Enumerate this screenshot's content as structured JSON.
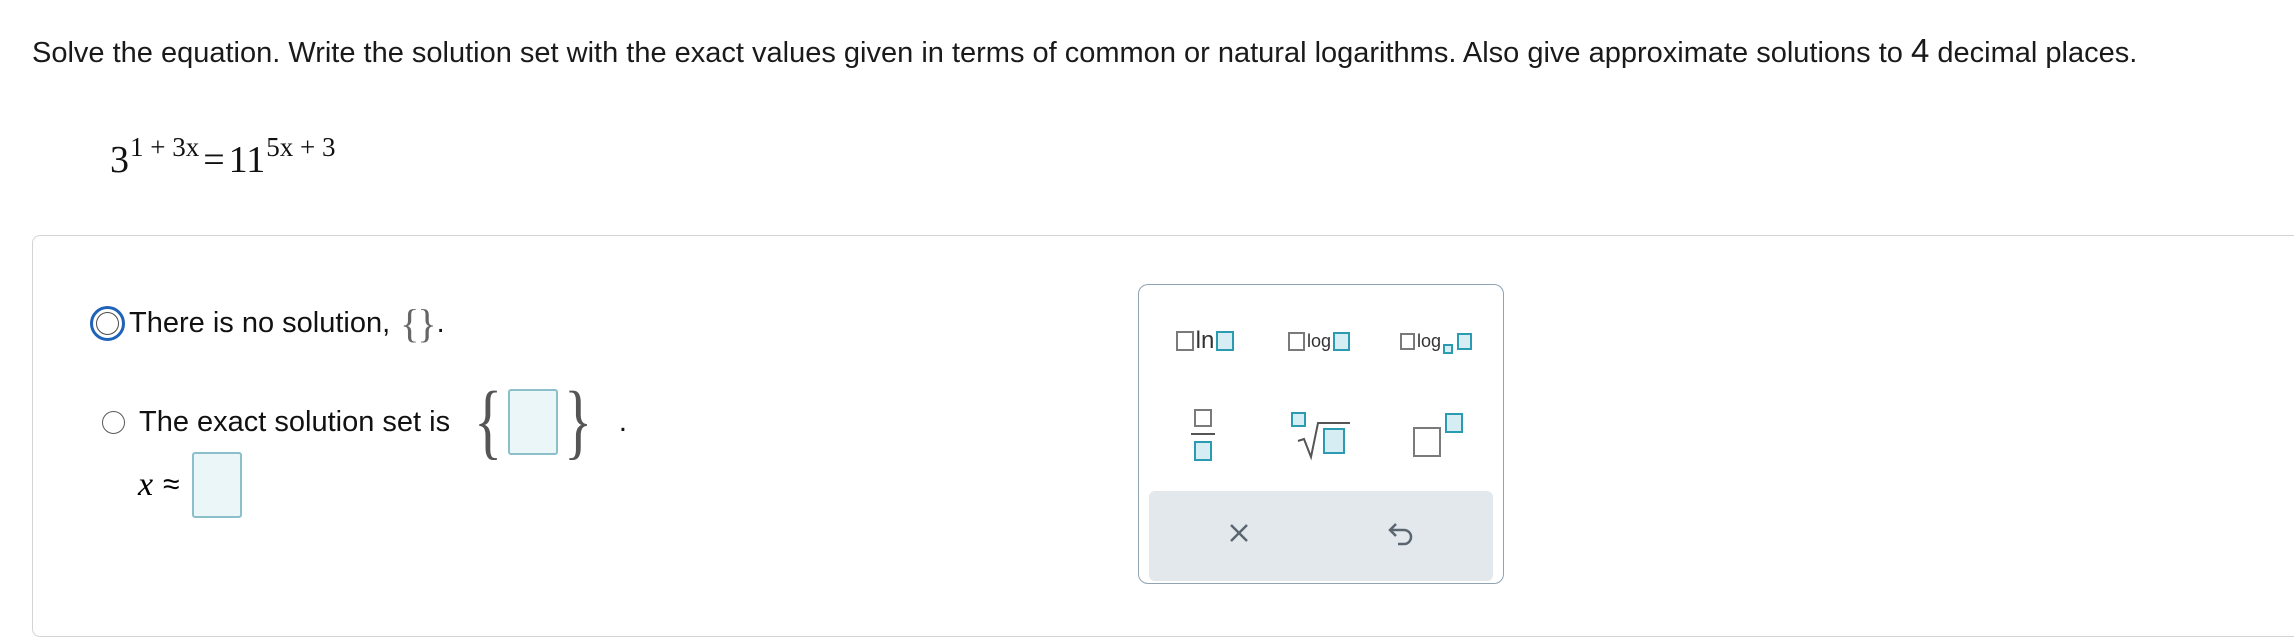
{
  "question": {
    "text_before": "Solve the equation. Write the solution set with the exact values given in terms of common or natural logarithms. Also give approximate solutions to ",
    "digits": "4",
    "text_after": " decimal places."
  },
  "equation": {
    "left_base": "3",
    "left_exponent": "1 + 3x",
    "equals": "=",
    "right_base": "11",
    "right_exponent": "5x + 3"
  },
  "options": {
    "no_solution": {
      "label": "There is no solution,",
      "empty_set": "{}",
      "period": "."
    },
    "exact_set": {
      "label": "The exact solution set is",
      "open_brace": "{",
      "close_brace": "}",
      "period": "."
    }
  },
  "approx": {
    "variable": "x",
    "symbol": "≈"
  },
  "palette": {
    "buttons": [
      {
        "name": "ln-button",
        "label": "ln"
      },
      {
        "name": "log-button",
        "label": "log"
      },
      {
        "name": "log-base-button",
        "label": "log"
      }
    ]
  },
  "colors": {
    "focus_ring": "#1f63b8",
    "answer_box_border": "#8bbfca",
    "answer_box_fill": "#eaf6f8",
    "palette_teal": "#2a9bb0"
  }
}
